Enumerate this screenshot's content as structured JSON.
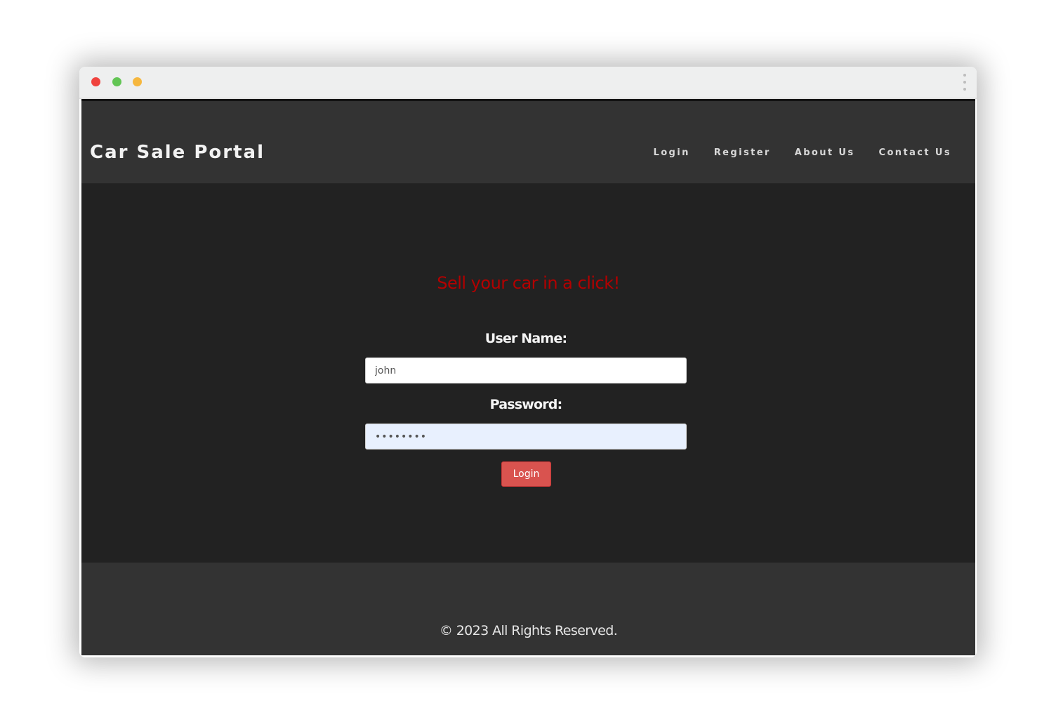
{
  "window": {
    "controls": {
      "close_color": "#f0433e",
      "minimize_color": "#62c554",
      "zoom_color": "#f6b73e"
    },
    "menu_icon": "kebab-menu-icon"
  },
  "header": {
    "brand": "Car Sale Portal",
    "nav": {
      "login": "Login",
      "register": "Register",
      "about": "About Us",
      "contact": "Contact Us"
    }
  },
  "main": {
    "tagline": "Sell your car in a click!",
    "tagline_color": "#b30000",
    "form": {
      "username_label": "User Name:",
      "username_value": "john",
      "password_label": "Password:",
      "password_value": "password",
      "submit_label": "Login",
      "submit_color": "#d9534f"
    }
  },
  "footer": {
    "copyright": "© 2023 All Rights Reserved."
  }
}
